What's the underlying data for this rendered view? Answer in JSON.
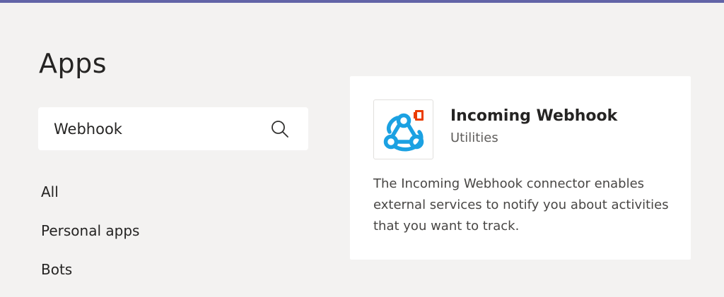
{
  "colors": {
    "accent": "#6264a7",
    "background": "#f3f2f1",
    "card": "#ffffff",
    "webhook_icon": "#1ba1e2",
    "office_badge": "#eb3c00"
  },
  "page": {
    "title": "Apps"
  },
  "search": {
    "value": "Webhook",
    "icon": "search-icon"
  },
  "nav": {
    "items": [
      {
        "label": "All"
      },
      {
        "label": "Personal apps"
      },
      {
        "label": "Bots"
      }
    ]
  },
  "result_card": {
    "logo_icon": "webhook-icon",
    "badge_icon": "office-icon",
    "name": "Incoming Webhook",
    "category": "Utilities",
    "description": "The Incoming Webhook connector enables external services to notify you about activities that you want to track."
  }
}
